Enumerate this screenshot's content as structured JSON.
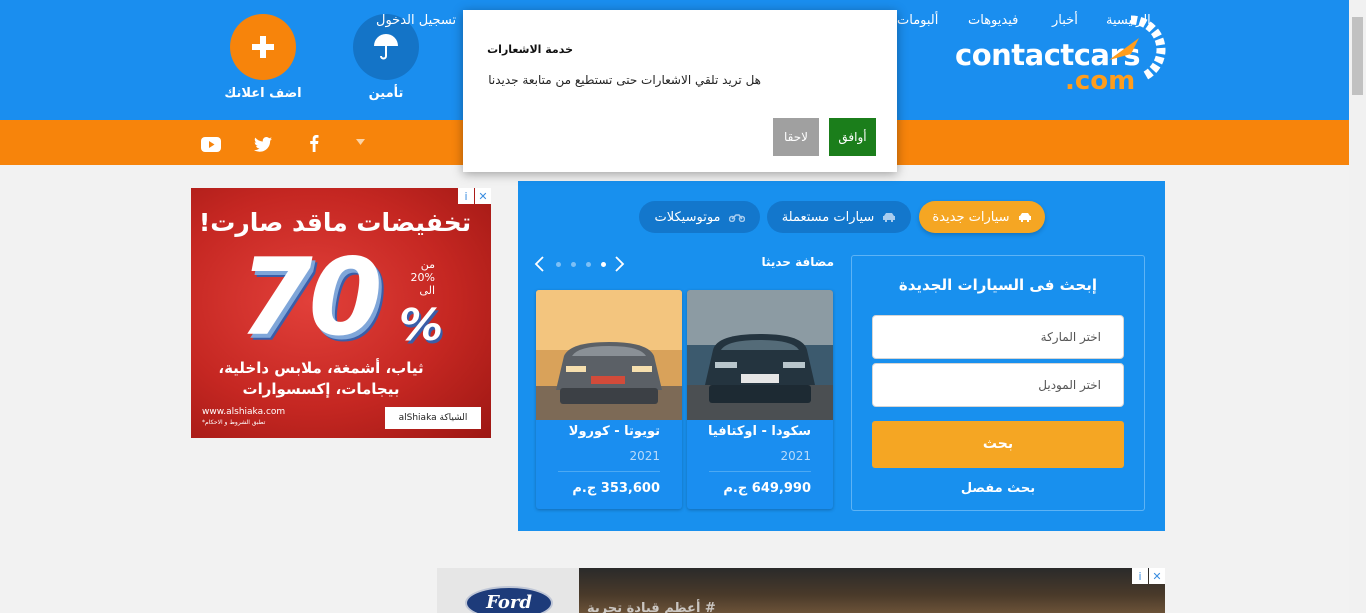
{
  "header": {
    "logo_main": "contactcars",
    "logo_sub": ".com",
    "add_ad_label": "اضف اعلانك",
    "insurance_label": "تأمين"
  },
  "nav": {
    "items": [
      "الرئيسية",
      "أخبار",
      "فيديوهات",
      "ألبومات"
    ],
    "login": "تسجيل الدخول",
    "social_icons": [
      "facebook-icon",
      "twitter-icon",
      "youtube-icon"
    ]
  },
  "ad_left": {
    "title": "تخفيضات ماقد صارت!",
    "big_number": "70",
    "percent_sign": "%",
    "range_from": "من",
    "range_value": "20%",
    "range_to": "الى",
    "body_line1": "ثياب، أشمغة، ملابس داخلية،",
    "body_line2": "بيجامات، إكسسوارات",
    "url": "www.alshiaka.com",
    "terms": "*تطبق الشروط و الاحكام",
    "brand": "alShiaka الشياكة"
  },
  "tabs": {
    "new_cars": "سيارات جديدة",
    "used_cars": "سيارات مستعملة",
    "motorcycles": "موتوسيكلات"
  },
  "search": {
    "title": "إبحث فى السيارات الجديدة",
    "brand_placeholder": "اختر الماركة",
    "model_placeholder": "اختر الموديل",
    "button": "بحث",
    "advanced": "بحث مفصل"
  },
  "recent": {
    "title": "مضافة حديثا",
    "cars": [
      {
        "name": "سكودا - اوكتافيا",
        "year": "2021",
        "price": "649,990",
        "currency": "ج.م"
      },
      {
        "name": "تويوتا - كورولا",
        "year": "2021",
        "price": "353,600",
        "currency": "ج.م"
      }
    ]
  },
  "ad_bottom": {
    "brand": "Ford",
    "text": "# أعظم قيادة تجربة"
  },
  "modal": {
    "title": "خدمة الاشعارات",
    "message": "هل تريد تلقي الاشعارات حتى تستطيع من متابعة جديدنا",
    "later": "لاحقا",
    "agree": "أوافق"
  },
  "colors": {
    "header_blue": "#1a8eef",
    "nav_orange": "#f7840b",
    "accent_orange": "#f5a623",
    "agree_green": "#1b7e1b"
  }
}
